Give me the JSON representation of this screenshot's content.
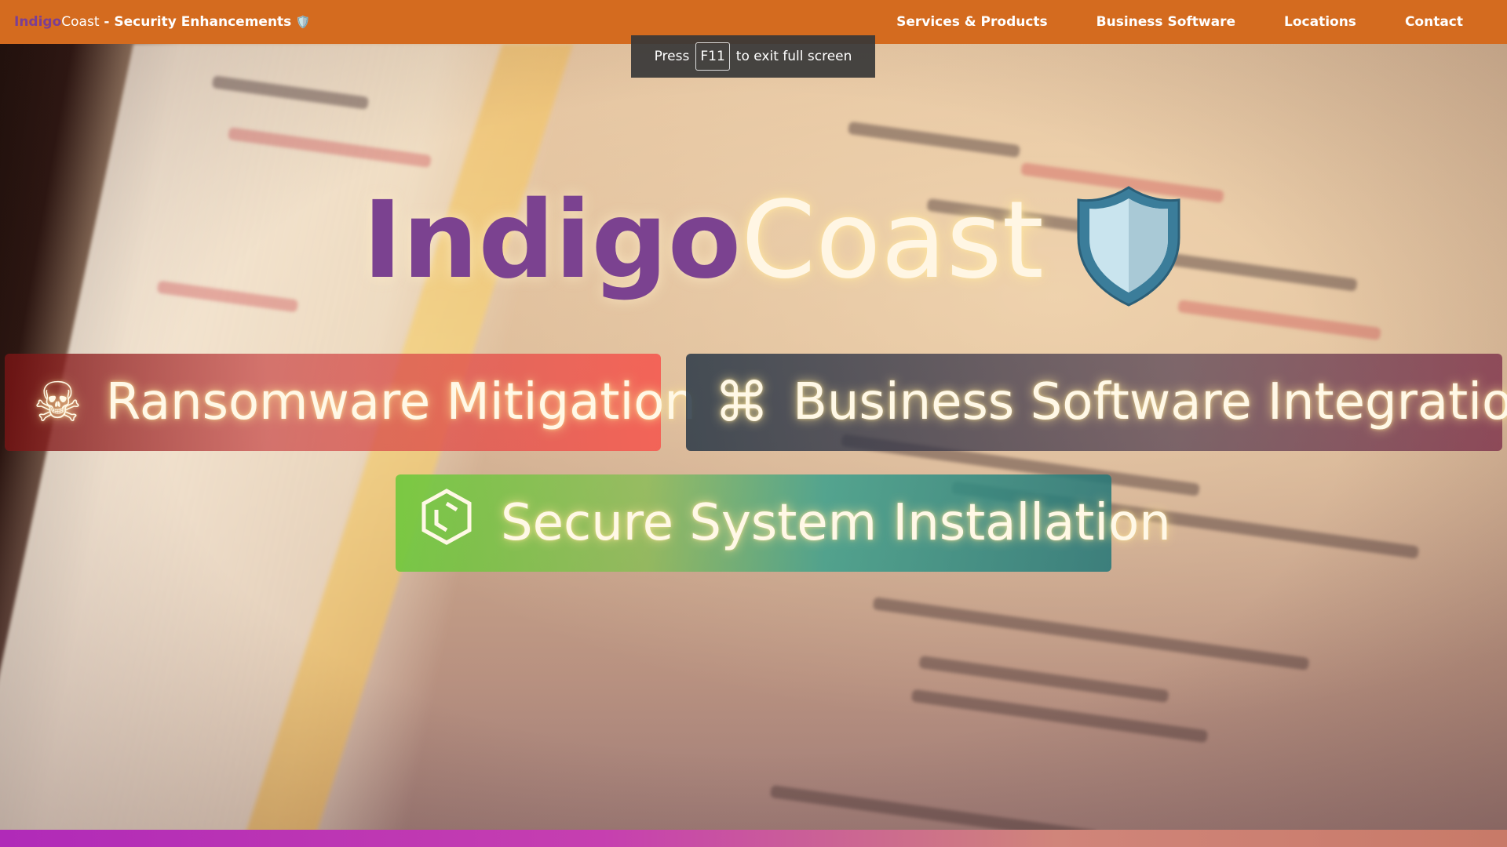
{
  "navbar": {
    "brand_indigo": "Indigo",
    "brand_coast": "Coast",
    "brand_separator": " - ",
    "brand_tagline": "Security Enhancements",
    "brand_icon": "🛡️",
    "links": [
      {
        "label": "Services & Products"
      },
      {
        "label": "Business Software"
      },
      {
        "label": "Locations"
      },
      {
        "label": "Contact"
      }
    ],
    "background_color": "#d46b1f"
  },
  "fullscreen_notice": {
    "prefix": "Press",
    "key": "F11",
    "suffix": "to exit full screen"
  },
  "hero": {
    "title_part1": "Indigo",
    "title_part2": "Coast",
    "title_icon": "shield-icon",
    "title_part1_color": "#7b4290",
    "title_part2_color": "#fff6e4"
  },
  "services": [
    {
      "label": "Ransomware Mitigation",
      "icon": "☠",
      "icon_name": "skull-crossbones-icon"
    },
    {
      "label": "Business Software Integrations",
      "icon": "⌘",
      "icon_name": "command-key-icon"
    },
    {
      "label": "Secure System Installation",
      "icon": "⬡",
      "icon_name": "hexagon-icon"
    }
  ]
}
